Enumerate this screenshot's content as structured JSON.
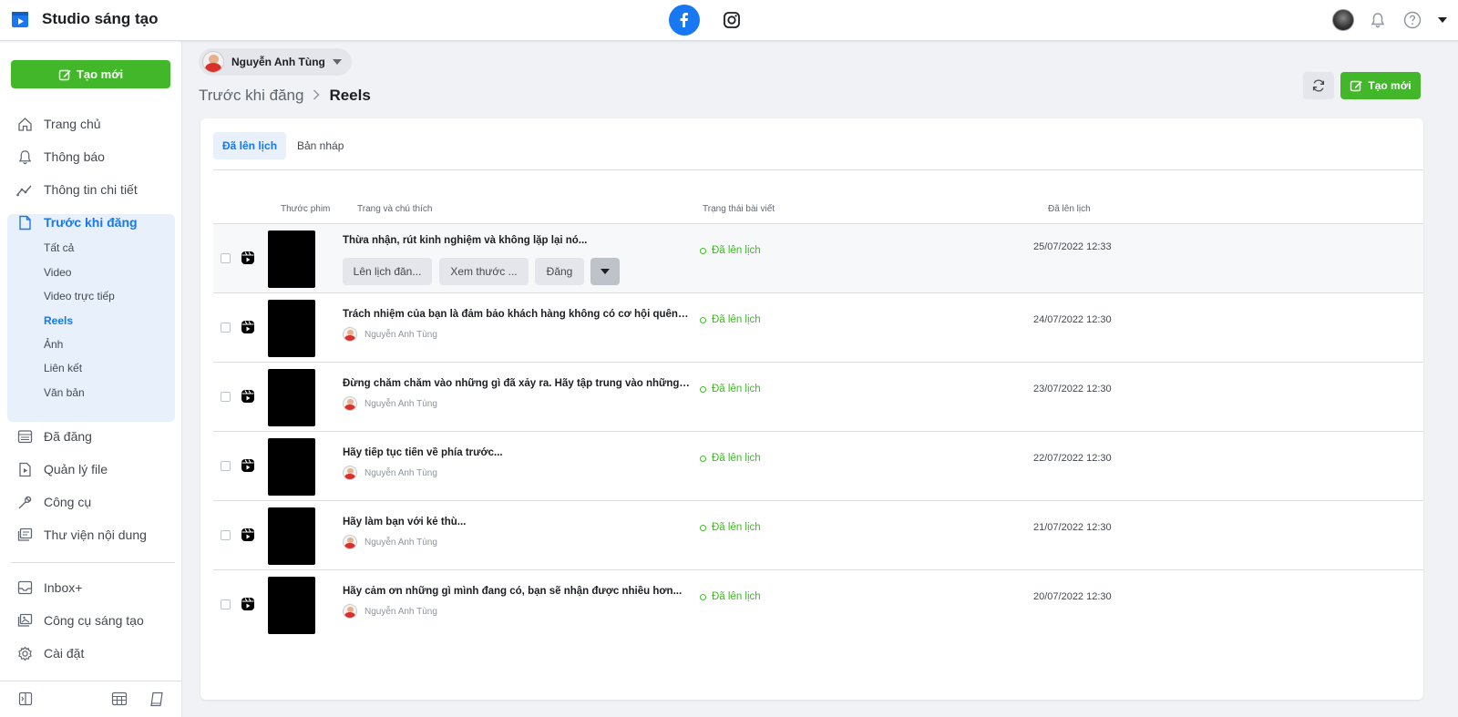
{
  "app": {
    "title": "Studio sáng tạo"
  },
  "header": {
    "platforms": [
      "facebook",
      "instagram"
    ],
    "icons": [
      "profile-avatar",
      "bell-icon",
      "help-icon",
      "caret-down-icon"
    ]
  },
  "sidebar": {
    "create_label": "Tạo mới",
    "items_top": [
      {
        "label": "Trang chủ",
        "icon": "home-icon"
      },
      {
        "label": "Thông báo",
        "icon": "bell-icon"
      },
      {
        "label": "Thông tin chi tiết",
        "icon": "insights-icon"
      }
    ],
    "active_item": {
      "label": "Trước khi đăng",
      "icon": "document-icon"
    },
    "sub_items": [
      "Tất cả",
      "Video",
      "Video trực tiếp",
      "Reels",
      "Ảnh",
      "Liên kết",
      "Văn bản"
    ],
    "active_sub": "Reels",
    "items_mid": [
      {
        "label": "Đã đăng",
        "icon": "calendar-icon"
      },
      {
        "label": "Quản lý file",
        "icon": "video-file-icon"
      },
      {
        "label": "Công cụ",
        "icon": "wrench-icon"
      },
      {
        "label": "Thư viện nội dung",
        "icon": "library-icon"
      }
    ],
    "items_bottom": [
      {
        "label": "Inbox+",
        "icon": "inbox-icon"
      },
      {
        "label": "Công cụ sáng tạo",
        "icon": "creative-tools-icon"
      },
      {
        "label": "Cài đặt",
        "icon": "gear-icon"
      }
    ]
  },
  "account": {
    "name": "Nguyễn Anh Tùng"
  },
  "breadcrumb": {
    "parent": "Trước khi đăng",
    "current": "Reels"
  },
  "toolbar": {
    "create_label": "Tạo mới"
  },
  "tabs": {
    "scheduled": "Đã lên lịch",
    "drafts": "Bản nháp"
  },
  "table": {
    "headers": {
      "preview": "Thước phim",
      "page_caption": "Trang và chú thích",
      "status": "Trạng thái bài viết",
      "scheduled": "Đã lên lịch"
    },
    "row_actions": {
      "schedule": "Lên lịch đăn...",
      "preview": "Xem thước ...",
      "publish": "Đăng"
    },
    "rows": [
      {
        "title": "Thừa nhận, rút kinh nghiệm và không lặp lại nó...",
        "author": "",
        "status": "Đã lên lịch",
        "date": "25/07/2022 12:33"
      },
      {
        "title": "Trách nhiệm của bạn là đảm bảo khách hàng không có cơ hội quên bạn...",
        "author": "Nguyễn Anh Tùng",
        "status": "Đã lên lịch",
        "date": "24/07/2022 12:30"
      },
      {
        "title": "Đừng chăm chăm vào những gì đã xảy ra. Hãy tập trung vào những việc...",
        "author": "Nguyễn Anh Tùng",
        "status": "Đã lên lịch",
        "date": "23/07/2022 12:30"
      },
      {
        "title": "Hãy tiếp tục tiến về phía trước...",
        "author": "Nguyễn Anh Tùng",
        "status": "Đã lên lịch",
        "date": "22/07/2022 12:30"
      },
      {
        "title": "Hãy làm bạn với kẻ thù...",
        "author": "Nguyễn Anh Tùng",
        "status": "Đã lên lịch",
        "date": "21/07/2022 12:30"
      },
      {
        "title": "Hãy cảm ơn những gì mình đang có, bạn sẽ nhận được nhiều hơn...",
        "author": "Nguyễn Anh Tùng",
        "status": "Đã lên lịch",
        "date": "20/07/2022 12:30"
      }
    ]
  },
  "colors": {
    "accent": "#1877f2",
    "create": "#42b72a",
    "status": "#42b72a"
  }
}
